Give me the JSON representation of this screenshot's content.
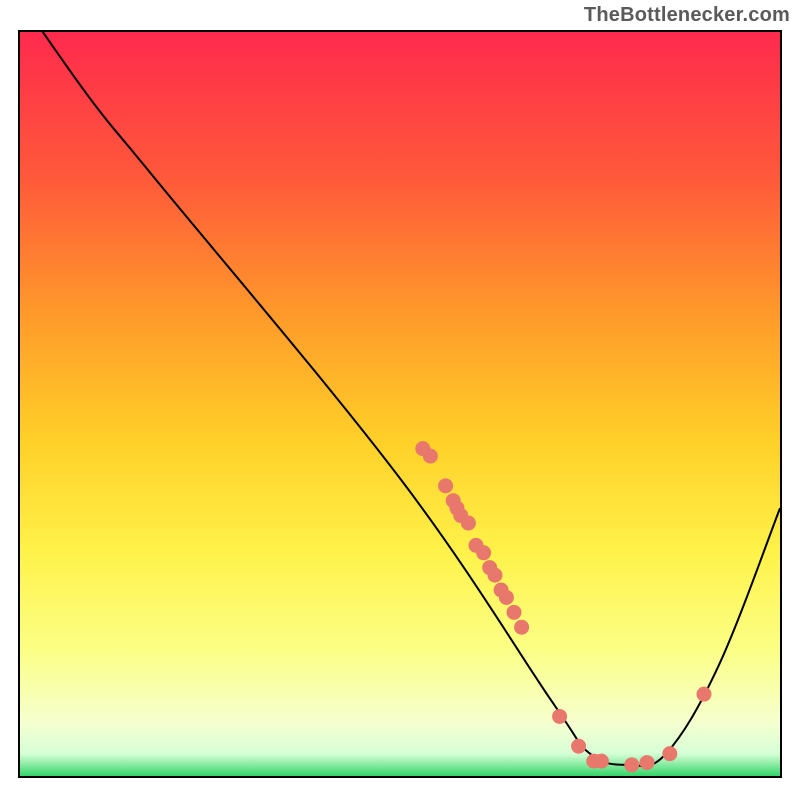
{
  "attribution": "TheBottlenecker.com",
  "chart_data": {
    "type": "line",
    "title": "",
    "xlabel": "",
    "ylabel": "",
    "xlim": [
      0,
      100
    ],
    "ylim": [
      0,
      100
    ],
    "grid": false,
    "background_gradient": {
      "stops": [
        {
          "pos": 0.0,
          "color": "#ff2a4d"
        },
        {
          "pos": 0.2,
          "color": "#ff5a3a"
        },
        {
          "pos": 0.38,
          "color": "#ff9a2a"
        },
        {
          "pos": 0.55,
          "color": "#ffd028"
        },
        {
          "pos": 0.7,
          "color": "#fff24a"
        },
        {
          "pos": 0.83,
          "color": "#fbff85"
        },
        {
          "pos": 0.93,
          "color": "#f5ffcf"
        },
        {
          "pos": 0.97,
          "color": "#d6ffd6"
        },
        {
          "pos": 1.0,
          "color": "#34d66a"
        }
      ]
    },
    "curve": [
      {
        "x": 3,
        "y": 100
      },
      {
        "x": 10,
        "y": 90
      },
      {
        "x": 18,
        "y": 80
      },
      {
        "x": 50,
        "y": 40
      },
      {
        "x": 70,
        "y": 10
      },
      {
        "x": 75,
        "y": 3
      },
      {
        "x": 80,
        "y": 1.5
      },
      {
        "x": 85,
        "y": 3
      },
      {
        "x": 92,
        "y": 15
      },
      {
        "x": 100,
        "y": 36
      }
    ],
    "scatter_points": [
      {
        "x": 53,
        "y": 44
      },
      {
        "x": 54,
        "y": 43
      },
      {
        "x": 56,
        "y": 39
      },
      {
        "x": 57,
        "y": 37
      },
      {
        "x": 57.5,
        "y": 36
      },
      {
        "x": 58,
        "y": 35
      },
      {
        "x": 59,
        "y": 34
      },
      {
        "x": 60,
        "y": 31
      },
      {
        "x": 61,
        "y": 30
      },
      {
        "x": 61.8,
        "y": 28
      },
      {
        "x": 62.5,
        "y": 27
      },
      {
        "x": 63.3,
        "y": 25
      },
      {
        "x": 64,
        "y": 24
      },
      {
        "x": 65,
        "y": 22
      },
      {
        "x": 66,
        "y": 20
      },
      {
        "x": 71,
        "y": 8
      },
      {
        "x": 73.5,
        "y": 4
      },
      {
        "x": 75.5,
        "y": 2
      },
      {
        "x": 76.5,
        "y": 2
      },
      {
        "x": 80.5,
        "y": 1.5
      },
      {
        "x": 82.5,
        "y": 1.8
      },
      {
        "x": 85.5,
        "y": 3
      },
      {
        "x": 90,
        "y": 11
      }
    ],
    "scatter_color": "#e8776c",
    "curve_color": "#000000"
  }
}
